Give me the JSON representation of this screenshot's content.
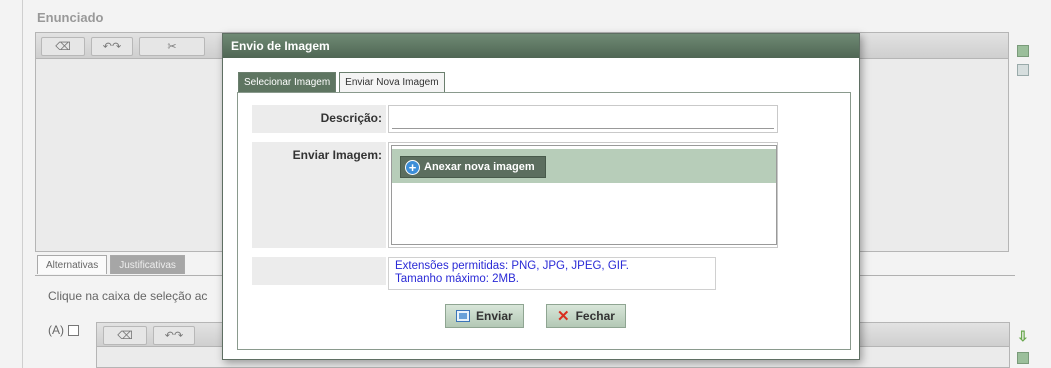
{
  "background": {
    "section_title": "Enunciado",
    "tabs": [
      {
        "label": "Alternativas",
        "active": true
      },
      {
        "label": "Justificativas",
        "active": false
      }
    ],
    "instruction_text": "Clique na caixa de seleção ac",
    "alternative_label": "(A)"
  },
  "dialog": {
    "title": "Envio de Imagem",
    "tabs": [
      {
        "label": "Selecionar Imagem",
        "active": false
      },
      {
        "label": "Enviar Nova Imagem",
        "active": true
      }
    ],
    "description_label": "Descrição:",
    "description_value": "",
    "upload_label": "Enviar Imagem:",
    "attach_button_label": "Anexar nova imagem",
    "allowed_extensions_text": "Extensões permitidas: PNG, JPG, JPEG, GIF.",
    "max_size_text": "Tamanho máximo: 2MB.",
    "send_button_label": "Enviar",
    "close_button_label": "Fechar"
  },
  "colors": {
    "dialog_title_bar": "#4f6654",
    "upload_band": "#b7cdb9",
    "info_text": "#2a2ad6",
    "close_icon": "#d92e1f"
  },
  "icons": [
    "plus-icon",
    "send-icon",
    "close-icon",
    "down-arrow-icon"
  ]
}
